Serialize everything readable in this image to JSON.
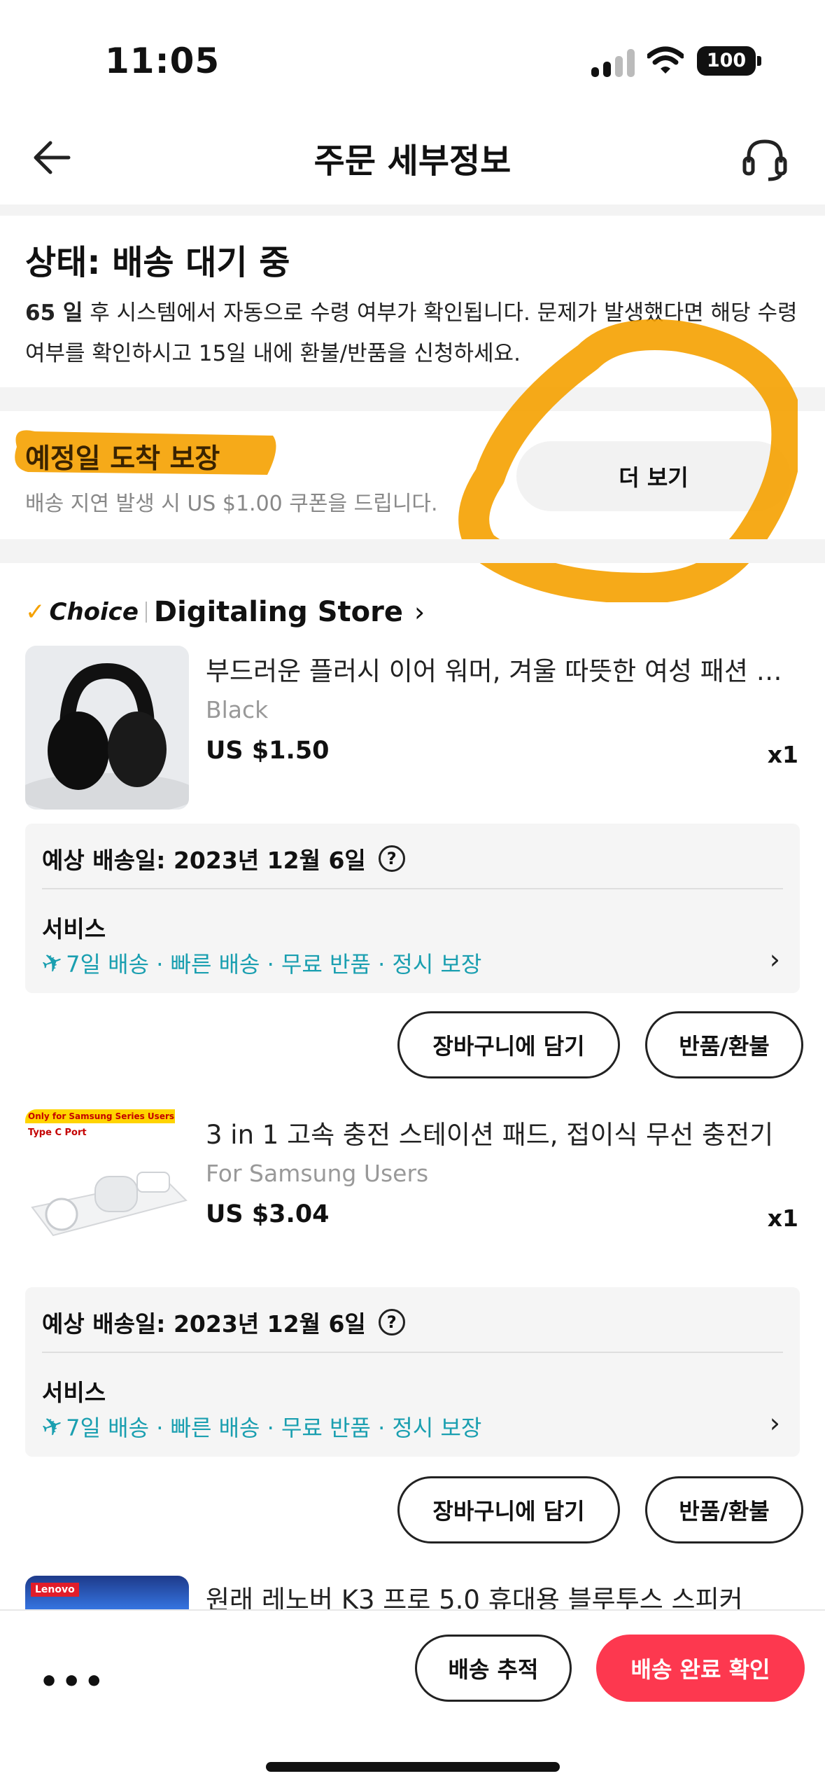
{
  "status_bar": {
    "time": "11:05",
    "battery": "100"
  },
  "header": {
    "title": "주문 세부정보"
  },
  "status": {
    "title": "상태: 배송 대기 중",
    "days_bold": "65 일",
    "description_rest": " 후 시스템에서 자동으로 수령 여부가 확인됩니다. 문제가 발생했다면 해당 수령 여부를 확인하시고 15일 내에 환불/반품을 신청하세요."
  },
  "guarantee": {
    "title": "예정일 도착 보장",
    "description": "배송 지연 발생 시 US $1.00 쿠폰을 드립니다.",
    "more_label": "더 보기"
  },
  "store": {
    "choice_label": "Choice",
    "name": "Digitaling Store"
  },
  "products": [
    {
      "title": "부드러운 플러시 이어 워머, 겨울 따뜻한 여성 패션 귀마개",
      "variant": "Black",
      "price": "US $1.50",
      "qty": "x1",
      "eta": "예상 배송일: 2023년 12월 6일",
      "service_label": "서비스",
      "service_text": "7일 배송 · 빠른 배송 · 무료 반품 · 정시 보장",
      "cart_label": "장바구니에 담기",
      "refund_label": "반품/환불"
    },
    {
      "title": "3 in 1 고속 충전 스테이션 패드, 접이식 무선 충전기",
      "variant": "For Samsung Users",
      "price": "US $3.04",
      "qty": "x1",
      "thumb_banner": "Only for Samsung Series Users",
      "thumb_sub": "Type C Port",
      "eta": "예상 배송일: 2023년 12월 6일",
      "service_label": "서비스",
      "service_text": "7일 배송 · 빠른 배송 · 무료 반품 · 정시 보장",
      "cart_label": "장바구니에 담기",
      "refund_label": "반품/환불"
    },
    {
      "title": "원래 레노버 K3 프로 5.0 휴대용 블루투스 스피커",
      "thumb_brand": "Lenovo"
    }
  ],
  "bottom_bar": {
    "track_label": "배송 추적",
    "confirm_label": "배송 완료 확인"
  },
  "colors": {
    "accent_red": "#fd384f",
    "service_teal": "#1a9fb0",
    "highlight_orange": "#f5a100"
  }
}
